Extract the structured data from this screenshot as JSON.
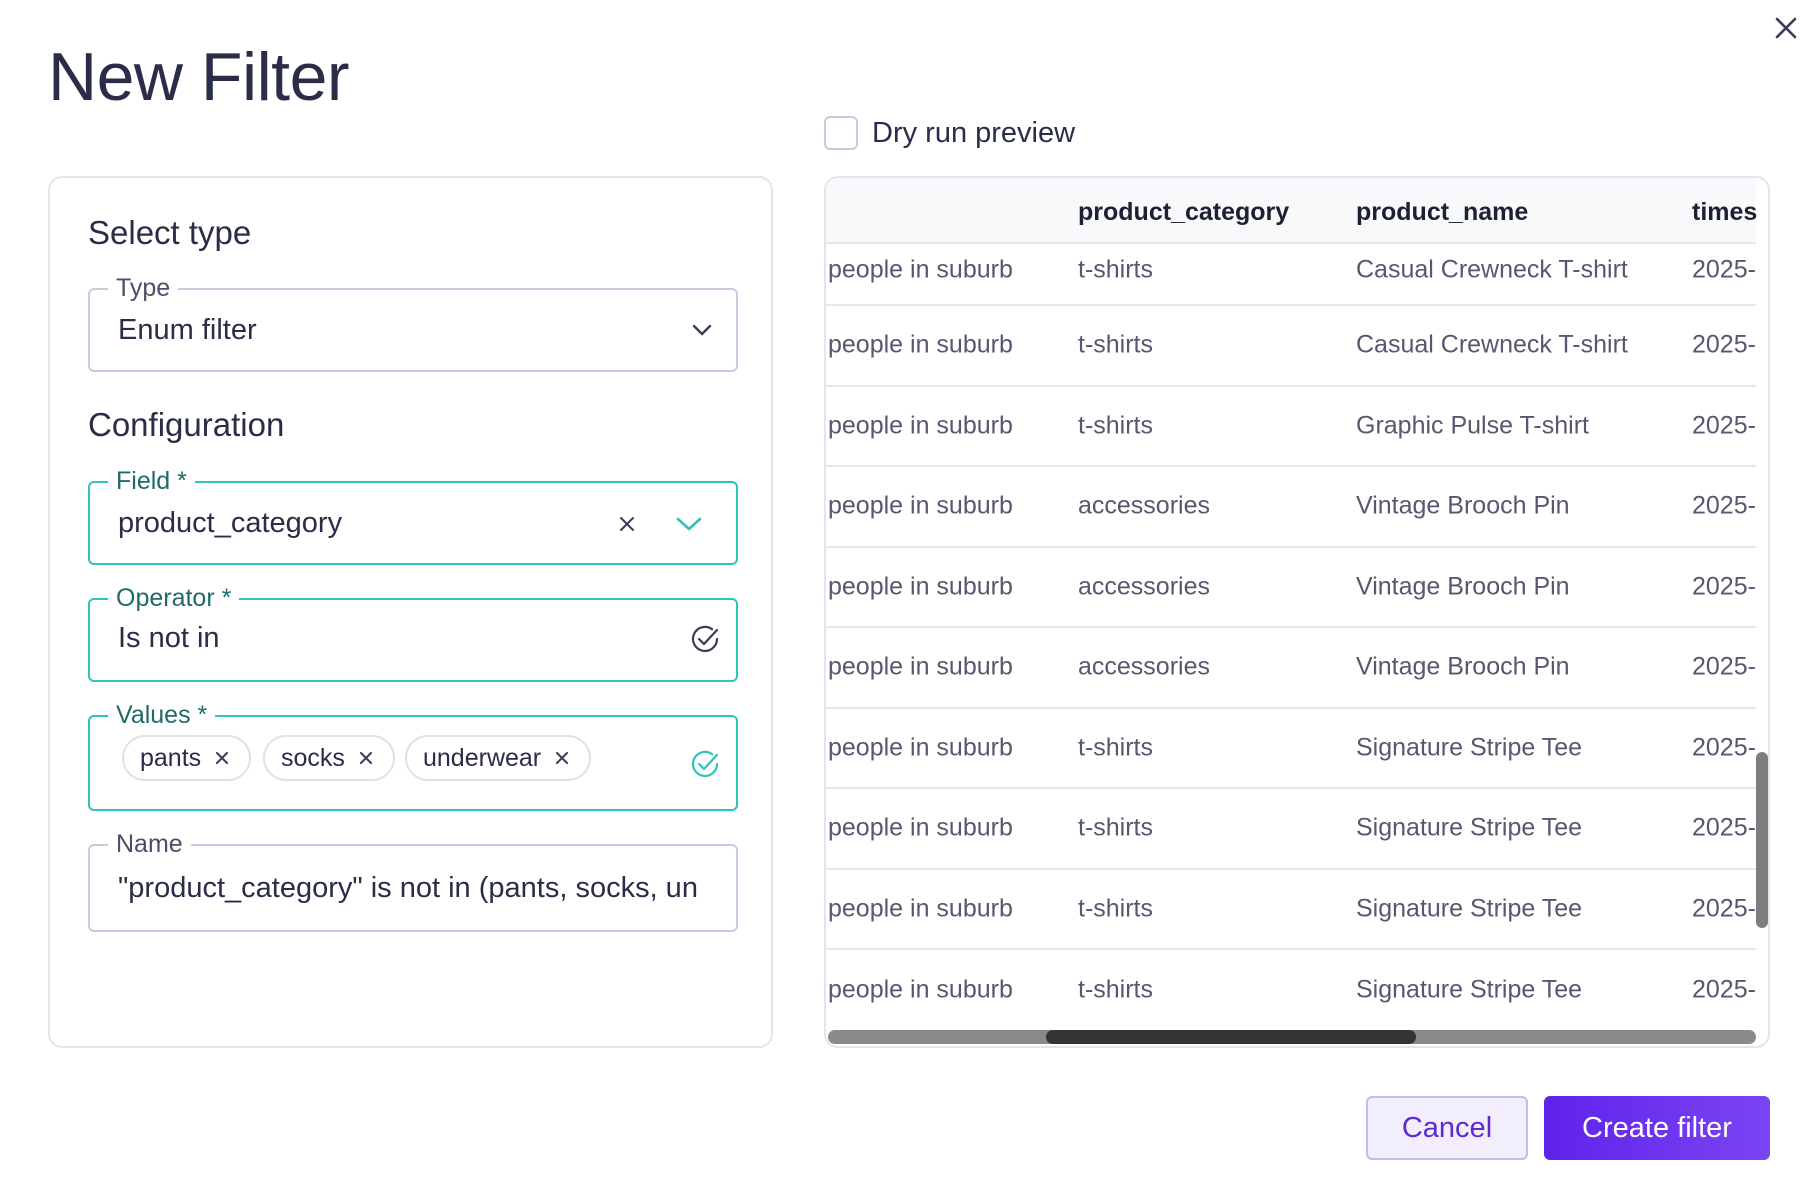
{
  "dialog": {
    "title": "New Filter",
    "close_icon": "close-icon"
  },
  "left": {
    "select_type_heading": "Select type",
    "type_field": {
      "label": "Type",
      "value": "Enum filter"
    },
    "configuration_heading": "Configuration",
    "field_field": {
      "label": "Field *",
      "value": "product_category"
    },
    "operator_field": {
      "label": "Operator *",
      "value": "Is not in"
    },
    "values_field": {
      "label": "Values *",
      "chips": [
        "pants",
        "socks",
        "underwear"
      ]
    },
    "name_field": {
      "label": "Name",
      "value": "\"product_category\" is not in (pants, socks, un"
    }
  },
  "preview": {
    "dry_run_label": "Dry run preview",
    "dry_run_checked": false,
    "columns": [
      "",
      "product_category",
      "product_name",
      "times"
    ],
    "rows": [
      [
        "people in suburb",
        "t-shirts",
        "Casual Crewneck T-shirt",
        "2025-"
      ],
      [
        "people in suburb",
        "t-shirts",
        "Casual Crewneck T-shirt",
        "2025-"
      ],
      [
        "people in suburb",
        "t-shirts",
        "Graphic Pulse T-shirt",
        "2025-"
      ],
      [
        "people in suburb",
        "accessories",
        "Vintage Brooch Pin",
        "2025-"
      ],
      [
        "people in suburb",
        "accessories",
        "Vintage Brooch Pin",
        "2025-"
      ],
      [
        "people in suburb",
        "accessories",
        "Vintage Brooch Pin",
        "2025-"
      ],
      [
        "people in suburb",
        "t-shirts",
        "Signature Stripe Tee",
        "2025-"
      ],
      [
        "people in suburb",
        "t-shirts",
        "Signature Stripe Tee",
        "2025-"
      ],
      [
        "people in suburb",
        "t-shirts",
        "Signature Stripe Tee",
        "2025-"
      ],
      [
        "people in suburb",
        "t-shirts",
        "Signature Stripe Tee",
        "2025-"
      ]
    ]
  },
  "footer": {
    "cancel_label": "Cancel",
    "create_label": "Create filter"
  },
  "colors": {
    "accent": "#6b2ff0",
    "active_border": "#2fc4ba",
    "title": "#2a2d48"
  }
}
